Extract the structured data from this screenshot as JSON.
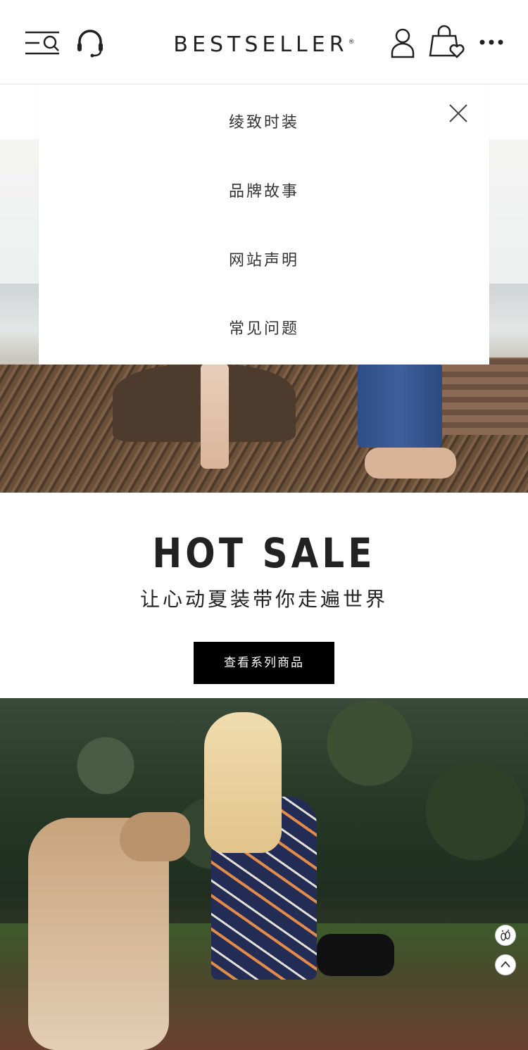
{
  "header": {
    "logo_text": "BESTSELLER",
    "logo_reg": "®",
    "icons": {
      "menu": "menu-search-icon",
      "support": "headset-icon",
      "account": "user-icon",
      "bag": "shopping-bag-heart-icon",
      "more": "more-dots-icon"
    }
  },
  "dropdown": {
    "items": [
      {
        "label": "绫致时装"
      },
      {
        "label": "品牌故事"
      },
      {
        "label": "网站声明"
      },
      {
        "label": "常见问题"
      }
    ],
    "close_icon": "close-icon"
  },
  "hot_sale": {
    "title": "HOT SALE",
    "subtitle": "让心动夏装带你走遍世界",
    "button_label": "查看系列商品"
  },
  "floating": {
    "footprint_icon": "footprint-icon",
    "back_to_top_icon": "chevron-up-icon"
  },
  "colors": {
    "accent": "#000000",
    "text": "#222222",
    "panel": "#ffffff"
  }
}
